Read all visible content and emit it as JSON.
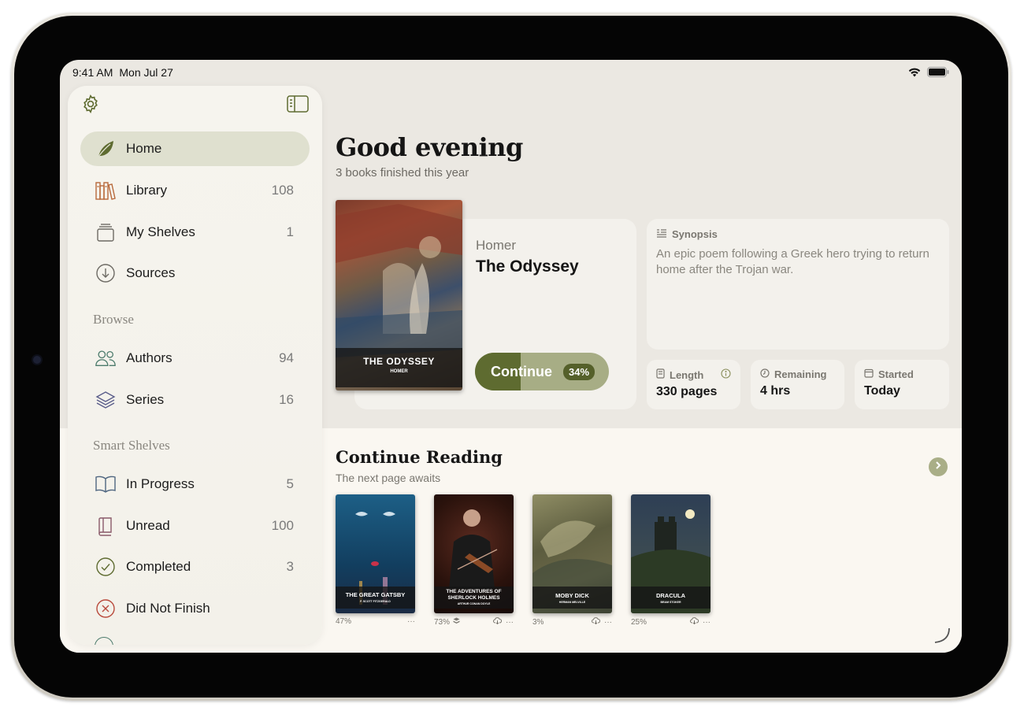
{
  "status_bar": {
    "time": "9:41 AM",
    "date": "Mon Jul 27"
  },
  "sidebar": {
    "items": [
      {
        "label": "Home",
        "count": "",
        "icon": "leaf-icon"
      },
      {
        "label": "Library",
        "count": "108",
        "icon": "books-icon"
      },
      {
        "label": "My Shelves",
        "count": "1",
        "icon": "shelves-icon"
      },
      {
        "label": "Sources",
        "count": "",
        "icon": "download-icon"
      }
    ],
    "browse_header": "Browse",
    "browse": [
      {
        "label": "Authors",
        "count": "94",
        "icon": "people-icon"
      },
      {
        "label": "Series",
        "count": "16",
        "icon": "stack-icon"
      }
    ],
    "smart_header": "Smart Shelves",
    "smart": [
      {
        "label": "In Progress",
        "count": "5",
        "icon": "open-book-icon"
      },
      {
        "label": "Unread",
        "count": "100",
        "icon": "closed-book-icon"
      },
      {
        "label": "Completed",
        "count": "3",
        "icon": "check-circle-icon"
      },
      {
        "label": "Did Not Finish",
        "count": "",
        "icon": "x-circle-icon"
      }
    ]
  },
  "header": {
    "title": "Good evening",
    "subtitle": "3 books finished this year"
  },
  "hero": {
    "cover_title": "THE ODYSSEY",
    "cover_author": "HOMER",
    "author": "Homer",
    "book": "The Odyssey",
    "continue_label": "Continue",
    "progress_label": "34%",
    "progress": 0.34,
    "synopsis_label": "Synopsis",
    "synopsis": "An epic poem following a Greek hero trying to return home after the Trojan war.",
    "stats": [
      {
        "label": "Length",
        "value": "330 pages"
      },
      {
        "label": "Remaining",
        "value": "4 hrs"
      },
      {
        "label": "Started",
        "value": "Today"
      }
    ]
  },
  "continue_reading": {
    "title": "Continue Reading",
    "subtitle": "The next page awaits",
    "books": [
      {
        "title": "THE GREAT GATSBY",
        "author": "F. SCOTT FITZGERALD",
        "progress": "47%"
      },
      {
        "title": "THE ADVENTURES OF SHERLOCK HOLMES",
        "author": "ARTHUR CONAN DOYLE",
        "progress": "73%"
      },
      {
        "title": "MOBY DICK",
        "author": "HERMAN MELVILLE",
        "progress": "3%"
      },
      {
        "title": "DRACULA",
        "author": "BRAM STOKER",
        "progress": "25%"
      }
    ]
  },
  "colors": {
    "accent": "#5e6b30",
    "accent_light": "#a7ad85",
    "sidebar_active": "#dfe0cf",
    "background": "#ebe8e2"
  }
}
